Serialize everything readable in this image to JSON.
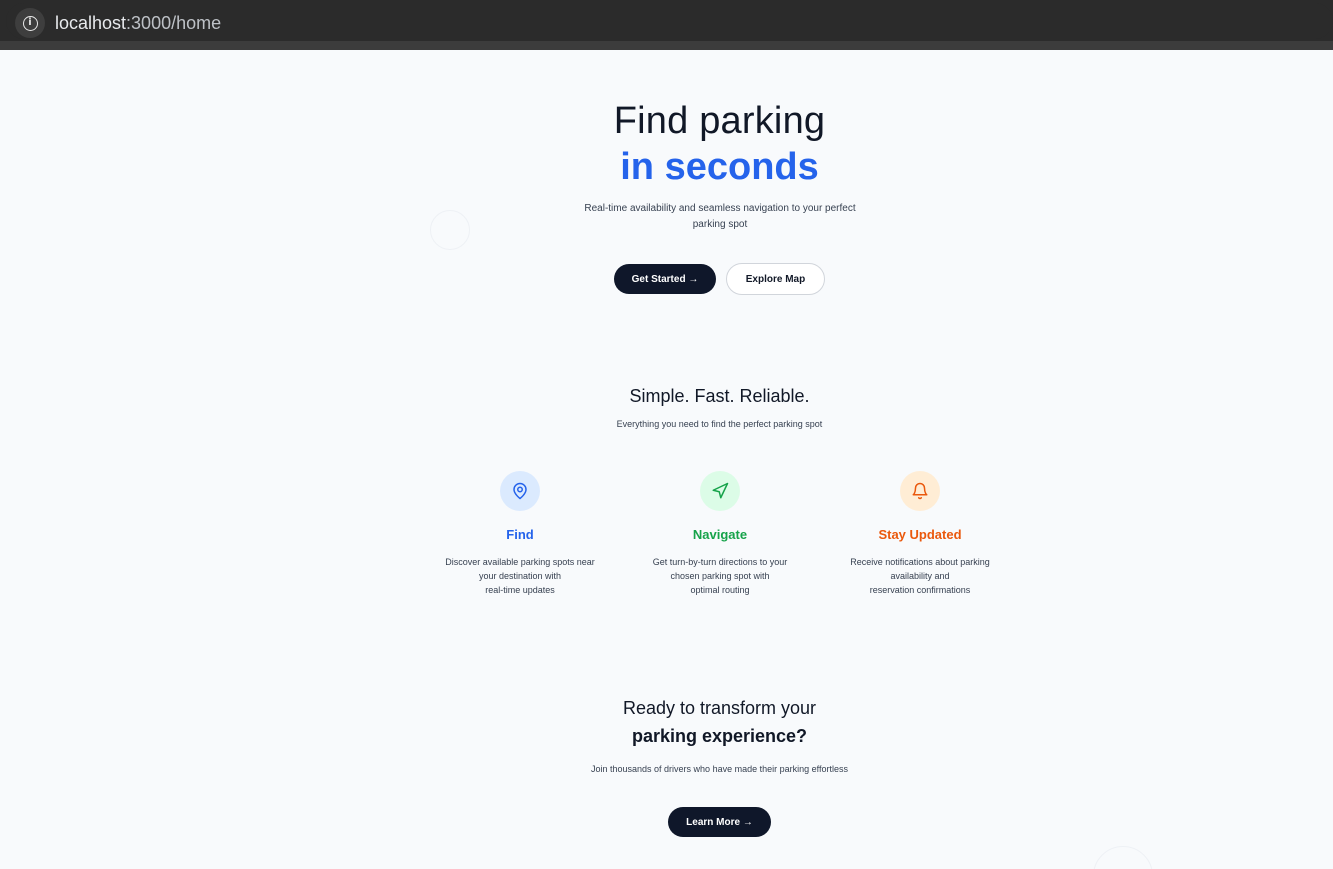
{
  "browser": {
    "url_host": "localhost",
    "url_path": ":3000/home",
    "info_icon": "info-icon"
  },
  "hero": {
    "title_line1": "Find parking",
    "title_line2": "in seconds",
    "subtitle_line1": "Real-time availability and seamless navigation to your perfect",
    "subtitle_line2": "parking spot",
    "primary_button": "Get Started →",
    "secondary_button": "Explore Map"
  },
  "features_section": {
    "title": "Simple. Fast. Reliable.",
    "subtitle": "Everything you need to find the perfect parking spot",
    "items": [
      {
        "title": "Find",
        "icon": "map-pin-icon",
        "color": "#2563eb",
        "bg": "#dbeafe",
        "desc_line1": "Discover available parking spots near",
        "desc_line2": "your destination with",
        "desc_line3": "real-time updates"
      },
      {
        "title": "Navigate",
        "icon": "navigation-arrow-icon",
        "color": "#16a34a",
        "bg": "#dcfce7",
        "desc_line1": "Get turn-by-turn directions to your",
        "desc_line2": "chosen parking spot with",
        "desc_line3": "optimal routing"
      },
      {
        "title": "Stay Updated",
        "icon": "bell-icon",
        "color": "#ea580c",
        "bg": "#ffedd5",
        "desc_line1": "Receive notifications about parking",
        "desc_line2": "availability and",
        "desc_line3": "reservation confirmations"
      }
    ]
  },
  "cta": {
    "title_line1": "Ready to transform your",
    "title_line2": "parking experience?",
    "subtitle": "Join thousands of drivers who have made their parking effortless",
    "button": "Learn More →"
  },
  "colors": {
    "accent": "#2563eb",
    "dark_button": "#0f172a",
    "background": "#f8fafc"
  }
}
